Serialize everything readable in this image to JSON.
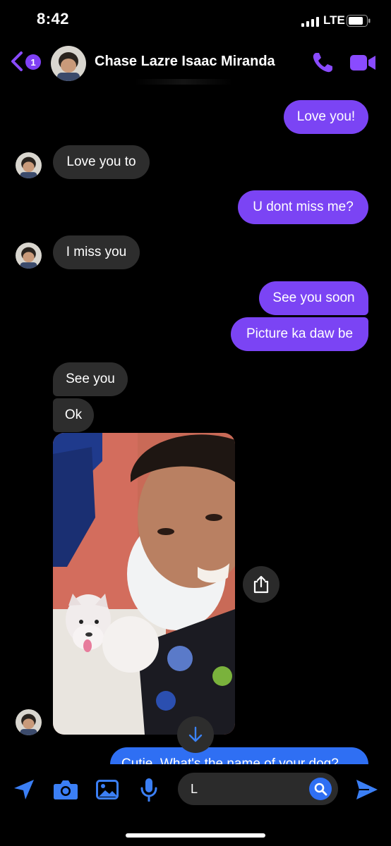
{
  "status_bar": {
    "time": "8:42",
    "network": "LTE"
  },
  "header": {
    "unread_count": "1",
    "contact_name": "Chase Lazre Isaac Miranda"
  },
  "messages": [
    {
      "text": "Love you!",
      "sender": "me"
    },
    {
      "text": "Love you to",
      "sender": "them"
    },
    {
      "text": "U dont miss me?",
      "sender": "me"
    },
    {
      "text": "I miss you",
      "sender": "them"
    },
    {
      "text": "See you soon",
      "sender": "me"
    },
    {
      "text": "Picture ka daw be",
      "sender": "me"
    },
    {
      "text": "See you",
      "sender": "them"
    },
    {
      "text": "Ok",
      "sender": "them"
    },
    {
      "text": "Cutie. What's the name of your dog?",
      "sender": "me"
    }
  ],
  "composer": {
    "value": "L"
  },
  "colors": {
    "accent": "#7b44f4",
    "blue": "#2f6ff3",
    "received": "#2d2d2d",
    "background": "#000000"
  },
  "icons": {
    "back": "chevron-left-icon",
    "call": "phone-icon",
    "video": "video-camera-icon",
    "share": "share-icon",
    "scroll": "arrow-down-icon",
    "location": "location-arrow-icon",
    "camera": "camera-icon",
    "gallery": "image-icon",
    "mic": "microphone-icon",
    "search": "search-icon",
    "send": "send-icon"
  }
}
